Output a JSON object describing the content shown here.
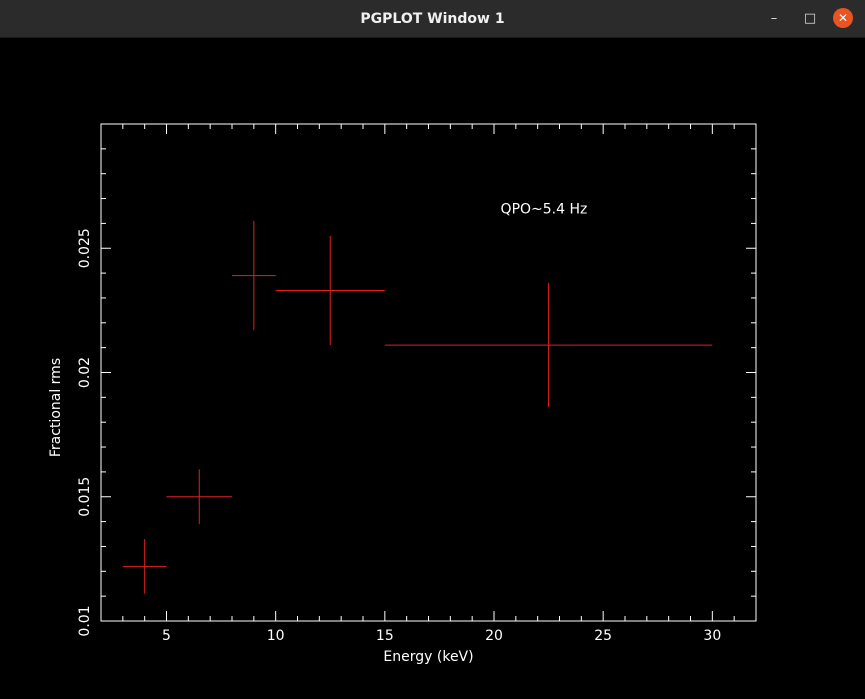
{
  "window": {
    "title": "PGPLOT Window 1"
  },
  "colors": {
    "axis": "#ffffff",
    "data": "#e02020",
    "background": "#000000",
    "close": "#e95420"
  },
  "icons": {
    "minimize": "minimize-icon",
    "maximize": "maximize-icon",
    "close": "close-icon"
  },
  "chart_data": {
    "type": "scatter",
    "xlabel": "Energy (keV)",
    "ylabel": "Fractional rms",
    "annotation": "QPO~5.4 Hz",
    "xlim": [
      2,
      32
    ],
    "ylim": [
      0.01,
      0.03
    ],
    "x_ticks": [
      5,
      10,
      15,
      20,
      25,
      30
    ],
    "y_ticks": [
      0.01,
      0.015,
      0.02,
      0.025
    ],
    "x_tick_labels": [
      "5",
      "10",
      "15",
      "20",
      "25",
      "30"
    ],
    "y_tick_labels": [
      "0.01",
      "0.015",
      "0.02",
      "0.025"
    ],
    "points": [
      {
        "x": 4,
        "xerr": 1,
        "y": 0.0122,
        "yerr": 0.0011
      },
      {
        "x": 6.5,
        "xerr": 1.5,
        "y": 0.015,
        "yerr": 0.0011
      },
      {
        "x": 9,
        "xerr": 1,
        "y": 0.0239,
        "yerr": 0.0022
      },
      {
        "x": 12.5,
        "xerr": 2.5,
        "y": 0.0233,
        "yerr": 0.0022
      },
      {
        "x": 22.5,
        "xerr": 7.5,
        "y": 0.0211,
        "yerr": 0.0025
      }
    ]
  }
}
